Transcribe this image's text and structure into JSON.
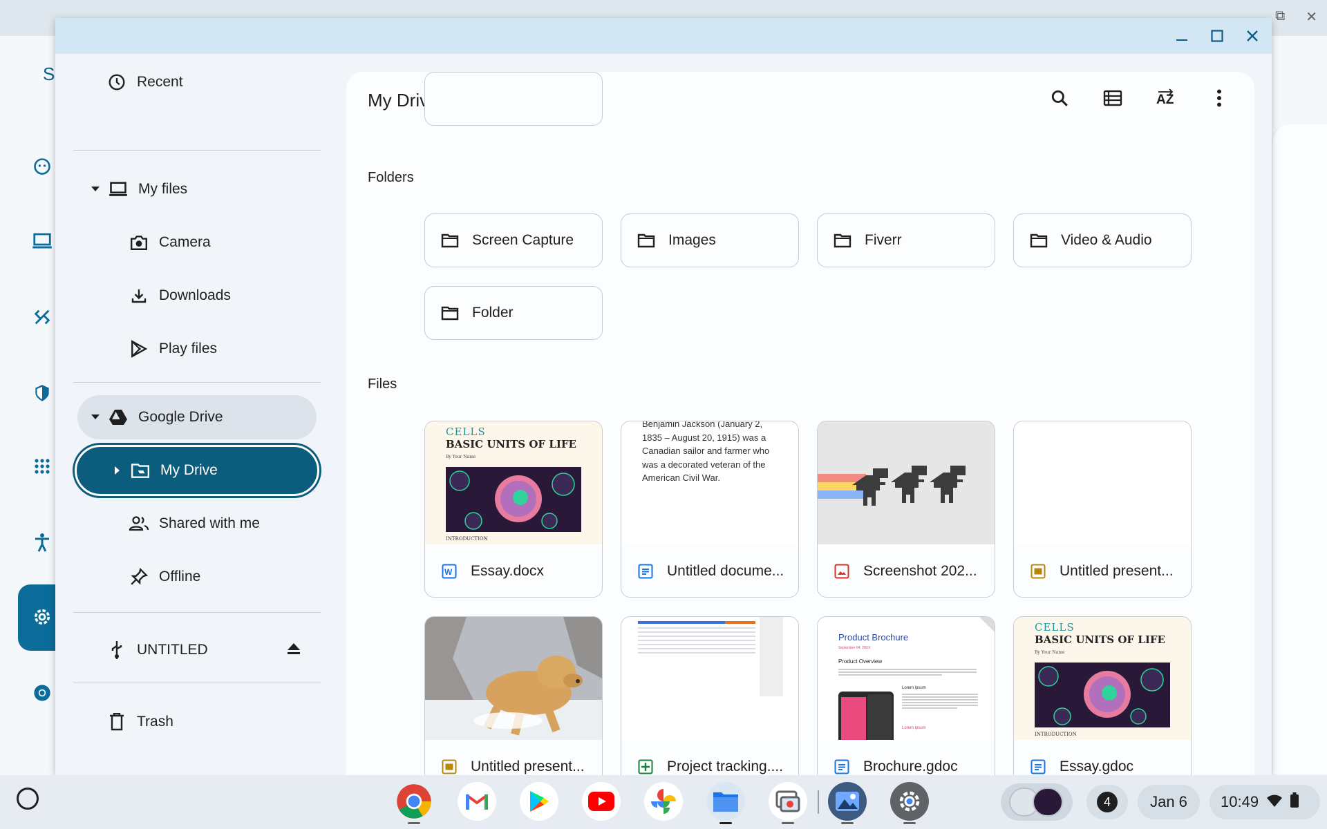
{
  "window": {
    "controls": [
      "minimize",
      "maximize",
      "close"
    ]
  },
  "background_app": {
    "letter": "S"
  },
  "sidebar": {
    "recent": "Recent",
    "my_files": "My files",
    "camera": "Camera",
    "downloads": "Downloads",
    "play_files": "Play files",
    "google_drive": "Google Drive",
    "my_drive": "My Drive",
    "shared_with_me": "Shared with me",
    "offline": "Offline",
    "untitled": "UNTITLED",
    "trash": "Trash"
  },
  "main": {
    "title": "My Drive",
    "folders_label": "Folders",
    "files_label": "Files",
    "folders": [
      {
        "name": "Screen Capture"
      },
      {
        "name": "Images"
      },
      {
        "name": "Fiverr"
      },
      {
        "name": "Video & Audio"
      },
      {
        "name": "Folder"
      }
    ],
    "files": [
      {
        "name": "Essay.docx",
        "type": "word"
      },
      {
        "name": "Untitled docume...",
        "type": "docs"
      },
      {
        "name": "Screenshot 202...",
        "type": "image"
      },
      {
        "name": "Untitled present...",
        "type": "slides"
      },
      {
        "name": "Untitled present...",
        "type": "slides"
      },
      {
        "name": "Project tracking....",
        "type": "sheets"
      },
      {
        "name": "Brochure.gdoc",
        "type": "docs"
      },
      {
        "name": "Essay.gdoc",
        "type": "docs"
      }
    ],
    "thumbs": {
      "essay_title1": "CELLS",
      "essay_title2": "BASIC UNITS OF LIFE",
      "essay_byline": "By Your Name",
      "essay_intro": "INTRODUCTION",
      "doc_text": "Benjamin Jackson (January 2, 1835 – August 20, 1915) was a Canadian sailor and farmer who was a decorated veteran of the American Civil War.",
      "brochure_title": "Product Brochure",
      "brochure_date": "September 04, 20XX",
      "brochure_overview": "Product Overview",
      "brochure_lorem": "Lorem ipsum",
      "brochure_lorem2": "Lorem ipsum"
    }
  },
  "shelf": {
    "notification_count": "4",
    "date": "Jan 6",
    "time": "10:49"
  },
  "colors": {
    "accent": "#0b5c7d",
    "docs_blue": "#1a73e8",
    "sheets_green": "#188038",
    "slides_yellow": "#b8860b",
    "image_red": "#d93025"
  }
}
